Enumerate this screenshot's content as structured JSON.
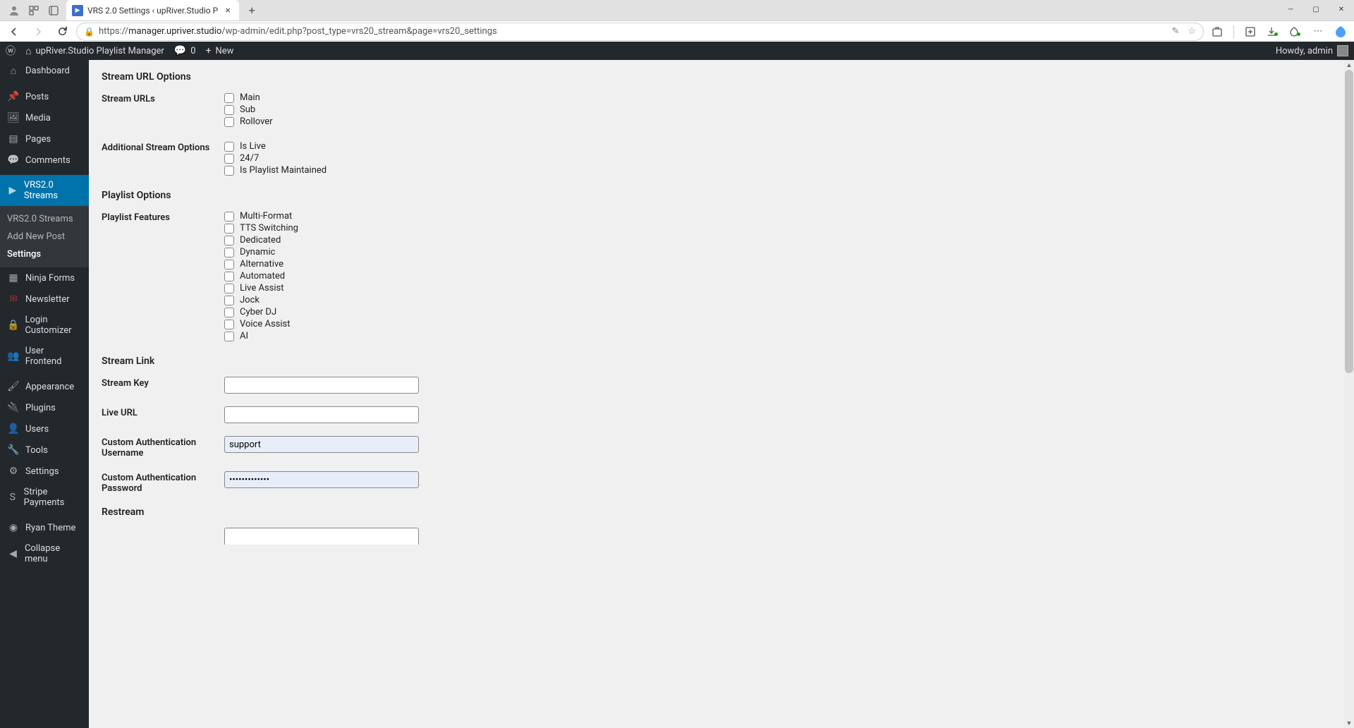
{
  "browser": {
    "tab_title": "VRS 2.0 Settings ‹ upRiver.Studio P",
    "url_host": "manager.upriver.studio",
    "url_path": "/wp-admin/edit.php?post_type=vrs20_stream&page=vrs20_settings",
    "url_prefix": "https://"
  },
  "wpbar": {
    "site_name": "upRiver.Studio Playlist Manager",
    "comments": "0",
    "new_label": "New",
    "howdy": "Howdy, admin"
  },
  "sidebar": {
    "items": [
      {
        "icon": "⌂",
        "label": "Dashboard"
      },
      {
        "icon": "📌",
        "label": "Posts"
      },
      {
        "icon": "🖼",
        "label": "Media"
      },
      {
        "icon": "▤",
        "label": "Pages"
      },
      {
        "icon": "💬",
        "label": "Comments"
      },
      {
        "icon": "▶",
        "label": "VRS2.0 Streams",
        "current": true
      },
      {
        "icon": "▦",
        "label": "Ninja Forms"
      },
      {
        "icon": "✉",
        "label": "Newsletter",
        "red": true
      },
      {
        "icon": "🔒",
        "label": "Login Customizer"
      },
      {
        "icon": "👥",
        "label": "User Frontend"
      },
      {
        "icon": "🖌",
        "label": "Appearance"
      },
      {
        "icon": "🔌",
        "label": "Plugins"
      },
      {
        "icon": "👤",
        "label": "Users"
      },
      {
        "icon": "🔧",
        "label": "Tools"
      },
      {
        "icon": "⚙",
        "label": "Settings"
      },
      {
        "icon": "S",
        "label": "Stripe Payments"
      },
      {
        "icon": "◉",
        "label": "Ryan Theme"
      },
      {
        "icon": "◀",
        "label": "Collapse menu"
      }
    ],
    "sub": [
      "VRS2.0 Streams",
      "Add New Post",
      "Settings"
    ]
  },
  "headings": {
    "stream_url": "Stream URL Options",
    "playlist": "Playlist Options",
    "stream_link": "Stream Link",
    "restream": "Restream"
  },
  "labels": {
    "stream_urls": "Stream URLs",
    "additional": "Additional Stream Options",
    "playlist_features": "Playlist Features",
    "stream_key": "Stream Key",
    "live_url": "Live URL",
    "custom_user": "Custom Authentication Username",
    "custom_pass": "Custom Authentication Password"
  },
  "checks": {
    "stream_urls": [
      "Main",
      "Sub",
      "Rollover"
    ],
    "additional": [
      "Is Live",
      "24/7",
      "Is Playlist Maintained"
    ],
    "playlist": [
      "Multi-Format",
      "TTS Switching",
      "Dedicated",
      "Dynamic",
      "Alternative",
      "Automated",
      "Live Assist",
      "Jock",
      "Cyber DJ",
      "Voice Assist",
      "AI"
    ]
  },
  "inputs": {
    "stream_key": "",
    "live_url": "",
    "custom_user": "support",
    "custom_pass": "•••••••••••••"
  }
}
